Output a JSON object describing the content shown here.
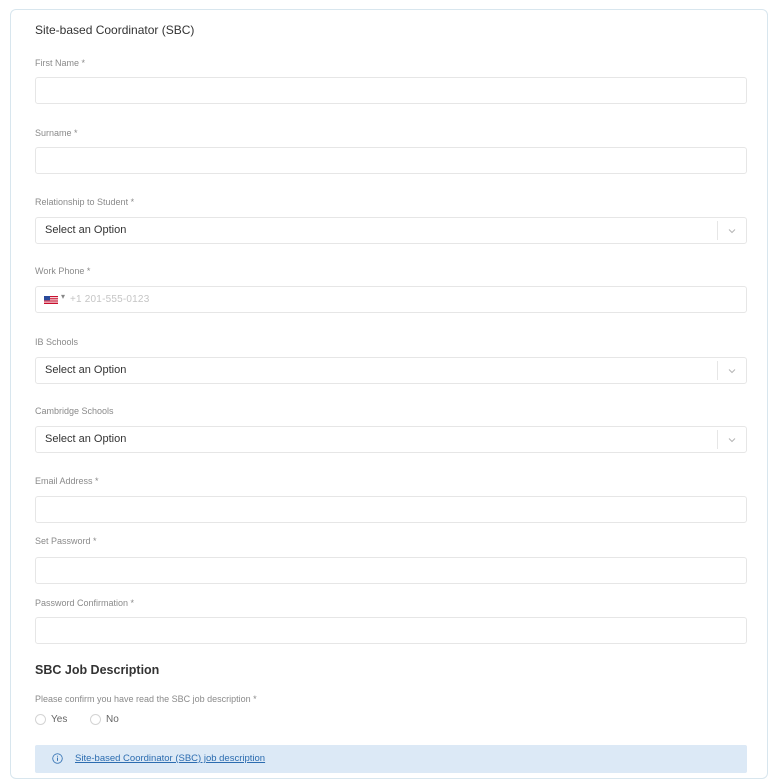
{
  "form": {
    "section_title": "Site-based Coordinator (SBC)",
    "first_name": {
      "label": "First Name *",
      "value": ""
    },
    "surname": {
      "label": "Surname *",
      "value": ""
    },
    "relationship": {
      "label": "Relationship to Student *",
      "selected": "Select an Option"
    },
    "work_phone": {
      "label": "Work Phone *",
      "placeholder": "+1 201-555-0123",
      "country_flag": "us-flag-icon"
    },
    "ib_schools": {
      "label": "IB Schools",
      "selected": "Select an Option"
    },
    "cambridge_schools": {
      "label": "Cambridge Schools",
      "selected": "Select an Option"
    },
    "email": {
      "label": "Email Address *",
      "value": ""
    },
    "password": {
      "label": "Set Password *",
      "value": ""
    },
    "password_confirmation": {
      "label": "Password Confirmation *",
      "value": ""
    }
  },
  "job_description": {
    "section_title": "SBC Job Description",
    "confirm_label": "Please confirm you have read the SBC job description *",
    "options": [
      "Yes",
      "No"
    ],
    "info_link": "Site-based Coordinator (SBC) job description"
  },
  "colors": {
    "border": "#e6e6e6",
    "label": "#8a8a8a",
    "info_bg": "#dce9f6",
    "link": "#2b6cb0"
  }
}
